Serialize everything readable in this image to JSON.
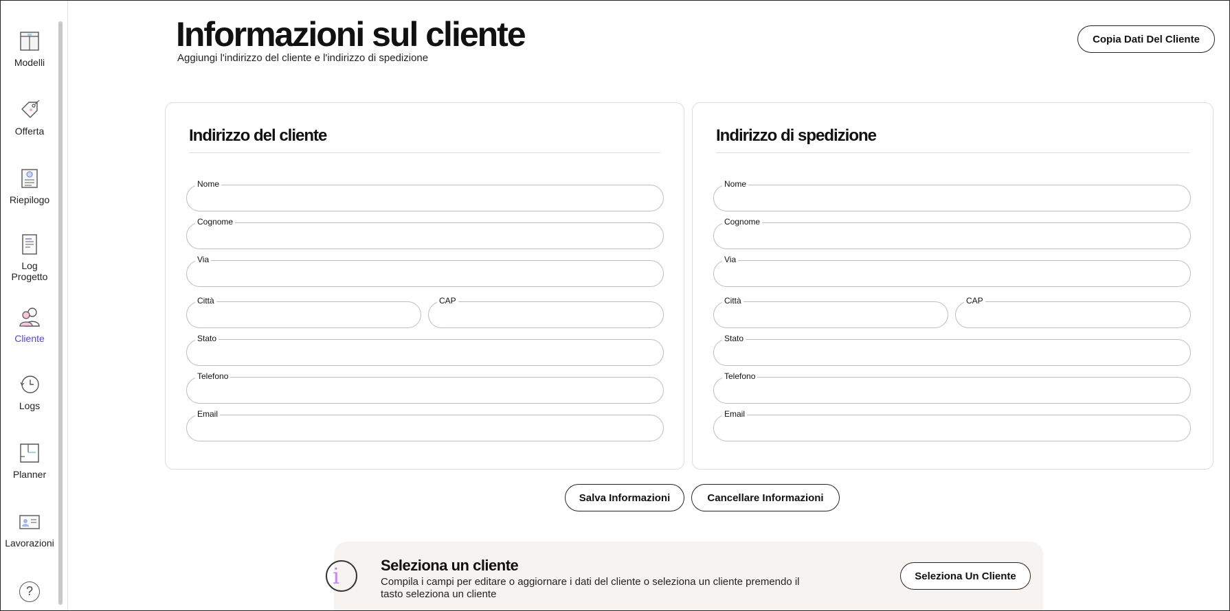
{
  "sidebar": {
    "items": [
      {
        "label": "Modelli",
        "icon": "template-icon"
      },
      {
        "label": "Offerta",
        "icon": "price-tag-icon"
      },
      {
        "label": "Riepilogo",
        "icon": "summary-document-icon"
      },
      {
        "label": "Log\nProgetto",
        "icon": "project-log-icon"
      },
      {
        "label": "Cliente",
        "icon": "client-users-icon",
        "active": true
      },
      {
        "label": "Logs",
        "icon": "history-clock-icon"
      },
      {
        "label": "Planner",
        "icon": "floor-planner-icon"
      },
      {
        "label": "Lavorazioni",
        "icon": "work-card-icon"
      }
    ],
    "help_icon": "?"
  },
  "header": {
    "title": "Informazioni sul cliente",
    "subtitle": "Aggiungi l'indirizzo del cliente e l'indirizzo di spedizione",
    "copy_button": "Copia Dati Del Cliente"
  },
  "customer_address": {
    "title": "Indirizzo del cliente",
    "fields": {
      "nome": {
        "label": "Nome",
        "value": ""
      },
      "cognome": {
        "label": "Cognome",
        "value": ""
      },
      "via": {
        "label": "Via",
        "value": ""
      },
      "citta": {
        "label": "Città",
        "value": ""
      },
      "cap": {
        "label": "CAP",
        "value": ""
      },
      "stato": {
        "label": "Stato",
        "value": ""
      },
      "telefono": {
        "label": "Telefono",
        "value": ""
      },
      "email": {
        "label": "Email",
        "value": ""
      }
    }
  },
  "shipping_address": {
    "title": "Indirizzo di spedizione",
    "fields": {
      "nome": {
        "label": "Nome",
        "value": ""
      },
      "cognome": {
        "label": "Cognome",
        "value": ""
      },
      "via": {
        "label": "Via",
        "value": ""
      },
      "citta": {
        "label": "Città",
        "value": ""
      },
      "cap": {
        "label": "CAP",
        "value": ""
      },
      "stato": {
        "label": "Stato",
        "value": ""
      },
      "telefono": {
        "label": "Telefono",
        "value": ""
      },
      "email": {
        "label": "Email",
        "value": ""
      }
    }
  },
  "actions": {
    "save": "Salva Informazioni",
    "clear": "Cancellare Informazioni"
  },
  "banner": {
    "icon": "i",
    "title": "Seleziona un cliente",
    "description": "Compila i campi per editare o aggiornare i dati del cliente o seleziona un cliente premendo il tasto seleziona un cliente",
    "button": "Seleziona Un Cliente"
  },
  "colors": {
    "accent": "#5b3fd0",
    "banner_bg": "#f7f3f0",
    "info_glyph": "#c48be8"
  }
}
